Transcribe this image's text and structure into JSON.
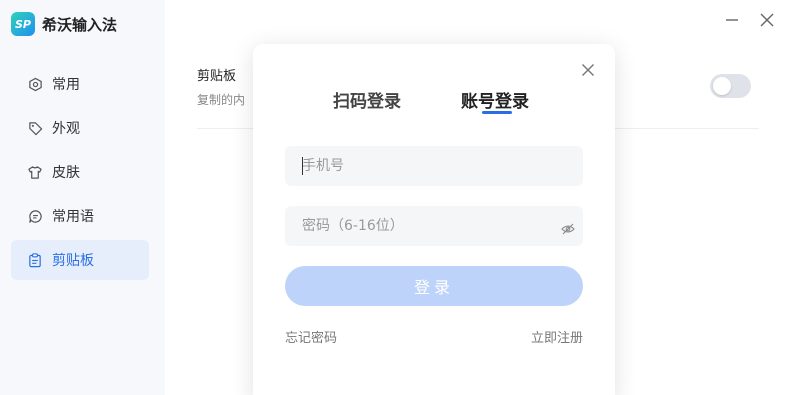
{
  "app": {
    "logo_text": "SP",
    "name": "希沃输入法"
  },
  "sidebar": {
    "items": [
      {
        "label": "常用",
        "icon": "hexagon-settings-icon",
        "active": false
      },
      {
        "label": "外观",
        "icon": "tag-icon",
        "active": false
      },
      {
        "label": "皮肤",
        "icon": "shirt-icon",
        "active": false
      },
      {
        "label": "常用语",
        "icon": "chat-bubble-icon",
        "active": false
      },
      {
        "label": "剪贴板",
        "icon": "clipboard-icon",
        "active": true
      }
    ]
  },
  "content": {
    "title": "剪贴板",
    "description": "复制的内",
    "toggle_on": false
  },
  "modal": {
    "tabs": [
      {
        "label": "扫码登录",
        "active": false
      },
      {
        "label": "账号登录",
        "active": true
      }
    ],
    "phone_placeholder": "手机号",
    "password_placeholder": "密码（6-16位）",
    "login_label": "登录",
    "forgot_label": "忘记密码",
    "register_label": "立即注册"
  },
  "colors": {
    "accent": "#2a6ee6",
    "login_button": "#bdd3fa",
    "sidebar_bg": "#f7f8fc",
    "active_item_bg": "#e6eefc"
  }
}
